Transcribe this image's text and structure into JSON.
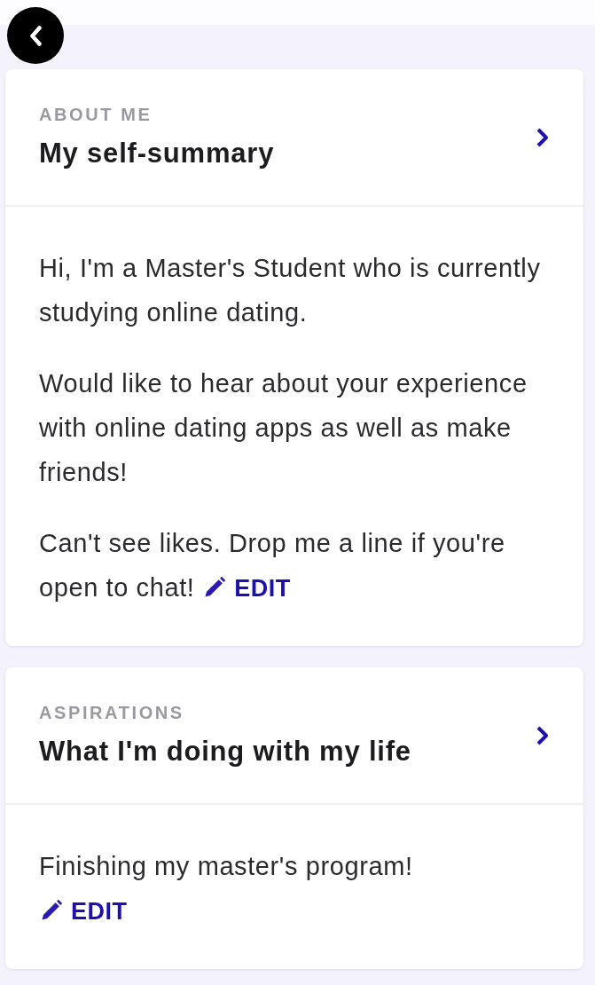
{
  "sections": [
    {
      "label": "ABOUT ME",
      "title": "My self-summary",
      "paragraphs": [
        "Hi, I'm a Master's Student who is currently studying online dating.",
        "Would like to hear about your experience with online dating apps as well as make friends!",
        "Can't see likes. Drop me a line if you're open to chat!"
      ],
      "edit": {
        "label": "EDIT",
        "kind": "inline"
      }
    },
    {
      "label": "ASPIRATIONS",
      "title": "What I'm doing with my life",
      "paragraphs": [
        "Finishing my master's program!"
      ],
      "edit": {
        "label": "EDIT",
        "kind": "block"
      }
    }
  ]
}
